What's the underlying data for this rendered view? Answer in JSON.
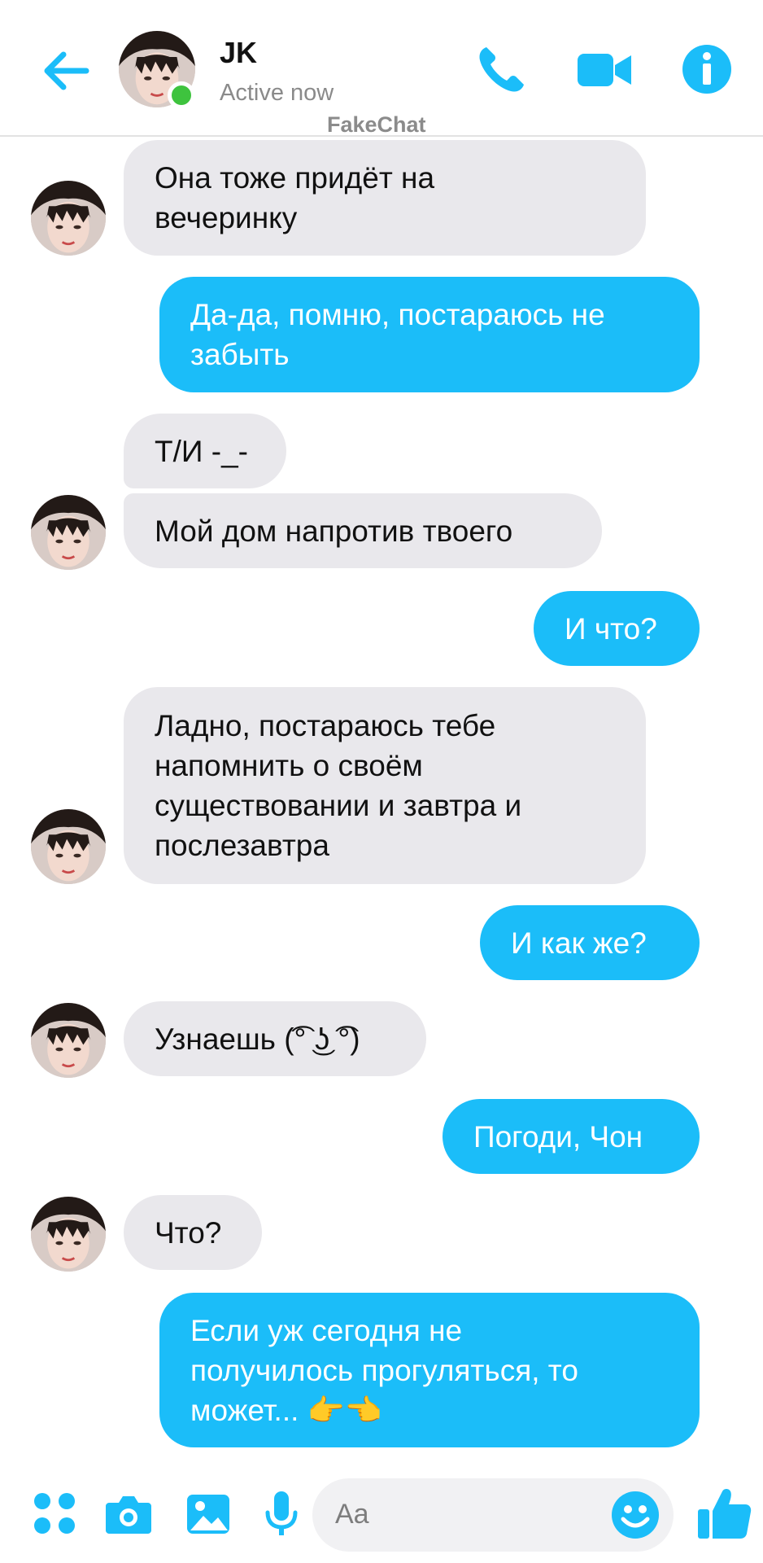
{
  "header": {
    "contact_name": "JK",
    "status": "Active now",
    "watermark": "FakeChat"
  },
  "messages": [
    {
      "side": "received",
      "text": "Она тоже придёт на\nвечеринку"
    },
    {
      "side": "sent",
      "text": "Да-да, помню, постараюсь не\nзабыть"
    },
    {
      "side": "received",
      "text": "Т/И -_-"
    },
    {
      "side": "received",
      "text": "Мой дом напротив твоего"
    },
    {
      "side": "sent",
      "text": "И что?"
    },
    {
      "side": "received",
      "text": "Ладно, постараюсь тебе\nнапомнить о своём\nсуществовании и завтра и\nпослезавтра"
    },
    {
      "side": "sent",
      "text": "И как же?"
    },
    {
      "side": "received",
      "text": "Узнаешь (͡° ͜ʖ ͡°)"
    },
    {
      "side": "sent",
      "text": "Погоди, Чон"
    },
    {
      "side": "received",
      "text": "Что?"
    },
    {
      "side": "sent",
      "text": "Если уж сегодня не\nполучилось прогуляться, то\nможет... 👉👈"
    }
  ],
  "composer": {
    "placeholder": "Aa"
  },
  "colors": {
    "accent": "#1bbdf9",
    "received_bubble": "#e9e8ec",
    "online": "#3ec33e"
  },
  "icons": [
    "back-arrow-icon",
    "phone-icon",
    "video-camera-icon",
    "info-icon",
    "apps-grid-icon",
    "camera-icon",
    "gallery-icon",
    "microphone-icon",
    "emoji-icon",
    "thumbs-up-icon"
  ]
}
